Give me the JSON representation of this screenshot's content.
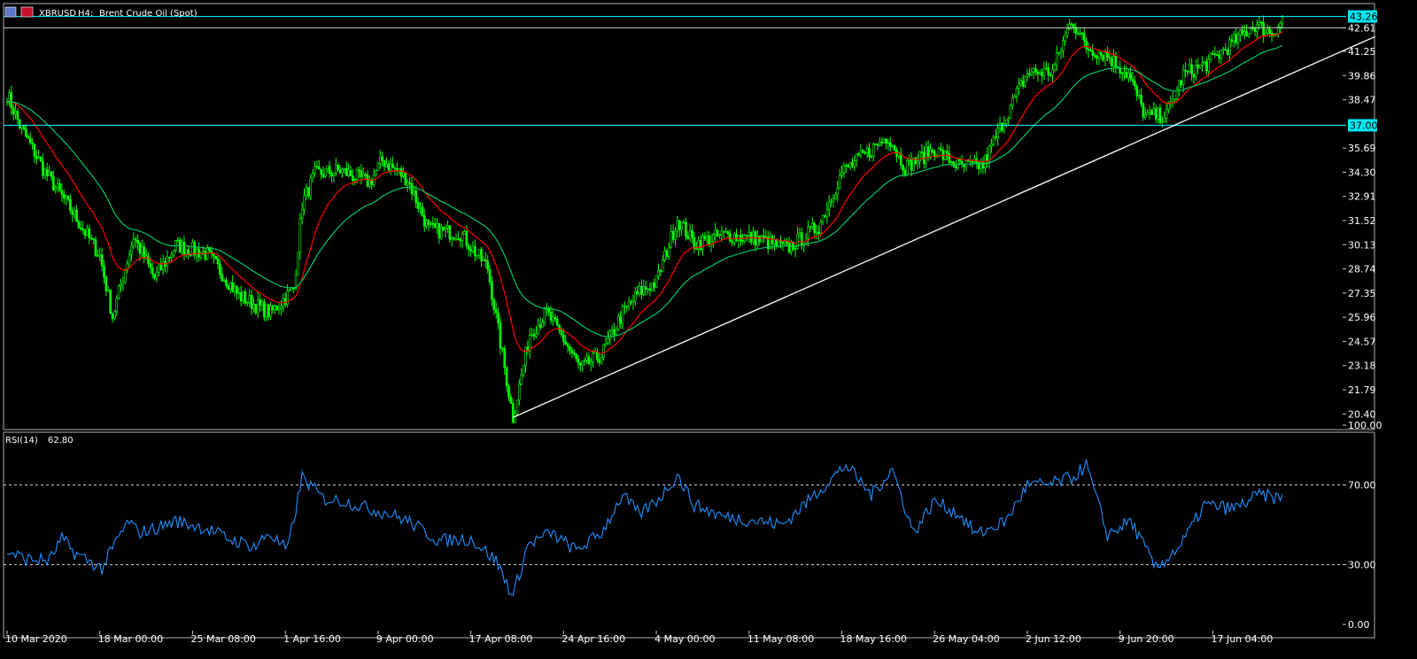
{
  "symbol": "XBRUSD",
  "timeframe": "H4:",
  "instrument": "Brent Crude Oil (Spot)",
  "colors": {
    "background": "#000000",
    "candle": "#00ff00",
    "ma_fast": "#ff0000",
    "ma_slow": "#00c864",
    "level": "#00e5ee",
    "trendline": "#ffffff",
    "rsi": "#1e90ff"
  },
  "price_axis": {
    "ticks": [
      "43.26",
      "42.61",
      "41.25",
      "39.86",
      "38.47",
      "37.00",
      "35.69",
      "34.30",
      "32.91",
      "31.52",
      "30.13",
      "28.74",
      "27.35",
      "25.96",
      "24.57",
      "23.18",
      "21.79",
      "20.40"
    ],
    "tick_values": [
      43.26,
      42.61,
      41.25,
      39.86,
      38.47,
      37.08,
      35.69,
      34.3,
      32.91,
      31.52,
      30.13,
      28.74,
      27.35,
      25.96,
      24.57,
      23.18,
      21.79,
      20.4
    ]
  },
  "levels": [
    {
      "label": "43.26",
      "value": 43.26
    },
    {
      "label": "37.00",
      "value": 37.0
    }
  ],
  "rsi": {
    "label": "RSI(14)",
    "value": "62.80",
    "ticks": [
      "100.00",
      "70.00",
      "30.00",
      "0.00"
    ],
    "tick_values": [
      100,
      70,
      30,
      0
    ]
  },
  "time_axis": {
    "labels": [
      "10 Mar 2020",
      "18 Mar 00:00",
      "25 Mar 08:00",
      "1 Apr 16:00",
      "9 Apr 00:00",
      "17 Apr 08:00",
      "24 Apr 16:00",
      "4 May 00:00",
      "11 May 08:00",
      "18 May 16:00",
      "26 May 04:00",
      "2 Jun 12:00",
      "9 Jun 20:00",
      "17 Jun 04:00"
    ],
    "bar_index": [
      0,
      44,
      88,
      132,
      176,
      220,
      264,
      308,
      352,
      396,
      440,
      484,
      528,
      572
    ]
  },
  "chart_data": {
    "type": "candlestick",
    "title": "XBRUSD, H4: Brent Crude Oil (Spot)",
    "bars": 606,
    "ylim": [
      19.6,
      43.9
    ],
    "price_anchors": [
      [
        0,
        38.8
      ],
      [
        6,
        37.0
      ],
      [
        18,
        34.3
      ],
      [
        30,
        32.2
      ],
      [
        44,
        29.5
      ],
      [
        50,
        26.0
      ],
      [
        60,
        30.6
      ],
      [
        70,
        28.2
      ],
      [
        80,
        30.1
      ],
      [
        95,
        29.6
      ],
      [
        110,
        27.2
      ],
      [
        125,
        26.2
      ],
      [
        136,
        27.6
      ],
      [
        140,
        32.5
      ],
      [
        146,
        34.2
      ],
      [
        158,
        34.4
      ],
      [
        172,
        33.7
      ],
      [
        178,
        35.0
      ],
      [
        190,
        33.9
      ],
      [
        200,
        31.0
      ],
      [
        215,
        30.8
      ],
      [
        228,
        28.8
      ],
      [
        234,
        24.5
      ],
      [
        240,
        20.2
      ],
      [
        248,
        25.0
      ],
      [
        256,
        26.2
      ],
      [
        264,
        24.7
      ],
      [
        272,
        23.0
      ],
      [
        282,
        23.8
      ],
      [
        292,
        26.2
      ],
      [
        300,
        27.4
      ],
      [
        308,
        28.0
      ],
      [
        318,
        31.6
      ],
      [
        326,
        30.2
      ],
      [
        340,
        30.7
      ],
      [
        355,
        30.5
      ],
      [
        370,
        29.9
      ],
      [
        385,
        31.2
      ],
      [
        396,
        34.3
      ],
      [
        410,
        35.6
      ],
      [
        418,
        36.4
      ],
      [
        426,
        34.6
      ],
      [
        440,
        35.6
      ],
      [
        452,
        34.6
      ],
      [
        463,
        34.7
      ],
      [
        472,
        37.1
      ],
      [
        484,
        40.0
      ],
      [
        496,
        40.1
      ],
      [
        505,
        43.1
      ],
      [
        512,
        41.5
      ],
      [
        522,
        41.0
      ],
      [
        532,
        39.9
      ],
      [
        540,
        37.5
      ],
      [
        550,
        37.6
      ],
      [
        558,
        39.9
      ],
      [
        570,
        40.6
      ],
      [
        580,
        41.6
      ],
      [
        592,
        42.8
      ],
      [
        600,
        42.3
      ],
      [
        605,
        43.1
      ]
    ],
    "rsi_anchors": [
      [
        0,
        37
      ],
      [
        8,
        33
      ],
      [
        20,
        32
      ],
      [
        26,
        43
      ],
      [
        32,
        36
      ],
      [
        45,
        28
      ],
      [
        53,
        44
      ],
      [
        58,
        52
      ],
      [
        62,
        46
      ],
      [
        70,
        48
      ],
      [
        80,
        52
      ],
      [
        95,
        48
      ],
      [
        105,
        43
      ],
      [
        118,
        39
      ],
      [
        124,
        46
      ],
      [
        133,
        37
      ],
      [
        140,
        74
      ],
      [
        150,
        63
      ],
      [
        160,
        62
      ],
      [
        172,
        58
      ],
      [
        180,
        56
      ],
      [
        190,
        52
      ],
      [
        205,
        42
      ],
      [
        220,
        43
      ],
      [
        232,
        32
      ],
      [
        240,
        14
      ],
      [
        247,
        40
      ],
      [
        258,
        46
      ],
      [
        270,
        37
      ],
      [
        282,
        46
      ],
      [
        292,
        65
      ],
      [
        300,
        55
      ],
      [
        310,
        64
      ],
      [
        318,
        75
      ],
      [
        326,
        60
      ],
      [
        340,
        54
      ],
      [
        356,
        52
      ],
      [
        368,
        50
      ],
      [
        380,
        62
      ],
      [
        392,
        74
      ],
      [
        398,
        80
      ],
      [
        410,
        65
      ],
      [
        420,
        78
      ],
      [
        430,
        46
      ],
      [
        440,
        62
      ],
      [
        452,
        55
      ],
      [
        460,
        45
      ],
      [
        474,
        52
      ],
      [
        484,
        70
      ],
      [
        494,
        70
      ],
      [
        506,
        74
      ],
      [
        512,
        80
      ],
      [
        522,
        45
      ],
      [
        533,
        52
      ],
      [
        545,
        28
      ],
      [
        557,
        40
      ],
      [
        568,
        60
      ],
      [
        582,
        58
      ],
      [
        594,
        65
      ],
      [
        605,
        63
      ]
    ],
    "moving_averages": [
      {
        "name": "",
        "period": 20
      },
      {
        "name": "",
        "period": 50
      }
    ],
    "trendline": {
      "from": [
        240,
        20.2
      ],
      "to": [
        649,
        42.1
      ]
    },
    "rsi_levels": [
      70,
      30
    ],
    "rsi_ylim": [
      0,
      100
    ]
  }
}
